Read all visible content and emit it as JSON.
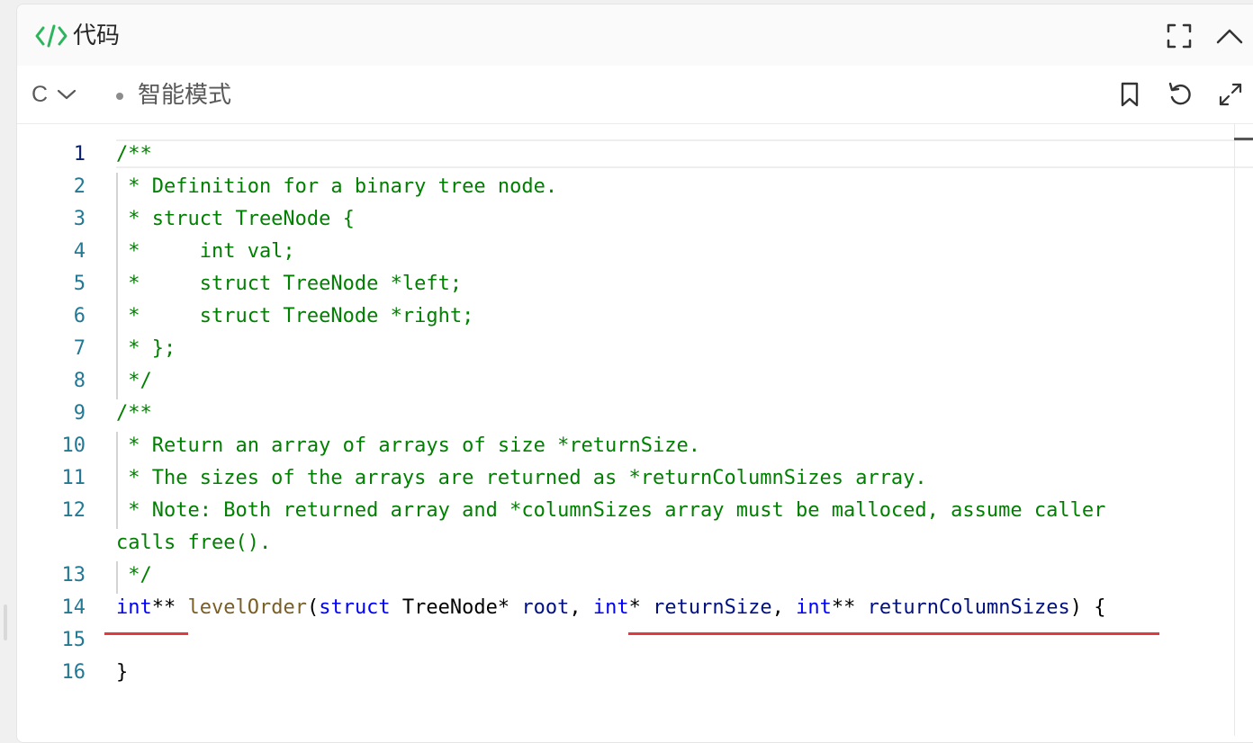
{
  "header": {
    "title": "代码",
    "icon": "code-icon",
    "actions": [
      "expand-icon",
      "collapse-up-icon"
    ]
  },
  "toolbar": {
    "language": "C",
    "mode": "智能模式",
    "actions": [
      "bookmark-icon",
      "reset-icon",
      "fullscreen-icon"
    ]
  },
  "editor": {
    "active_line": 1,
    "lines": [
      {
        "num": "1",
        "text": "/**"
      },
      {
        "num": "2",
        "text": " * Definition for a binary tree node."
      },
      {
        "num": "3",
        "text": " * struct TreeNode {"
      },
      {
        "num": "4",
        "text": " *     int val;"
      },
      {
        "num": "5",
        "text": " *     struct TreeNode *left;"
      },
      {
        "num": "6",
        "text": " *     struct TreeNode *right;"
      },
      {
        "num": "7",
        "text": " * };"
      },
      {
        "num": "8",
        "text": " */"
      },
      {
        "num": "9",
        "text": "/**"
      },
      {
        "num": "10",
        "text": " * Return an array of arrays of size *returnSize."
      },
      {
        "num": "11",
        "text": " * The sizes of the arrays are returned as *returnColumnSizes array."
      },
      {
        "num": "12",
        "text": " * Note: Both returned array and *columnSizes array must be malloced, assume caller"
      },
      {
        "num": "",
        "text": "calls free()."
      },
      {
        "num": "13",
        "text": " */"
      },
      {
        "num": "14",
        "tokens": [
          {
            "t": "int",
            "c": "kw"
          },
          {
            "t": "** ",
            "c": ""
          },
          {
            "t": "levelOrder",
            "c": "fn"
          },
          {
            "t": "(",
            "c": ""
          },
          {
            "t": "struct",
            "c": "kw"
          },
          {
            "t": " TreeNode* ",
            "c": ""
          },
          {
            "t": "root",
            "c": "pr"
          },
          {
            "t": ", ",
            "c": ""
          },
          {
            "t": "int",
            "c": "kw"
          },
          {
            "t": "* ",
            "c": ""
          },
          {
            "t": "returnSize",
            "c": "pr"
          },
          {
            "t": ", ",
            "c": ""
          },
          {
            "t": "int",
            "c": "kw"
          },
          {
            "t": "** ",
            "c": ""
          },
          {
            "t": "returnColumnSizes",
            "c": "pr"
          },
          {
            "t": ") {",
            "c": ""
          }
        ]
      },
      {
        "num": "15",
        "text": ""
      },
      {
        "num": "16",
        "text": "}"
      }
    ]
  },
  "colors": {
    "comment": "#008000",
    "keyword": "#0000ff",
    "function": "#795e26",
    "param": "#001080",
    "line_number": "#237893",
    "underline": "#e0393e",
    "accent_icon": "#2db55d"
  }
}
